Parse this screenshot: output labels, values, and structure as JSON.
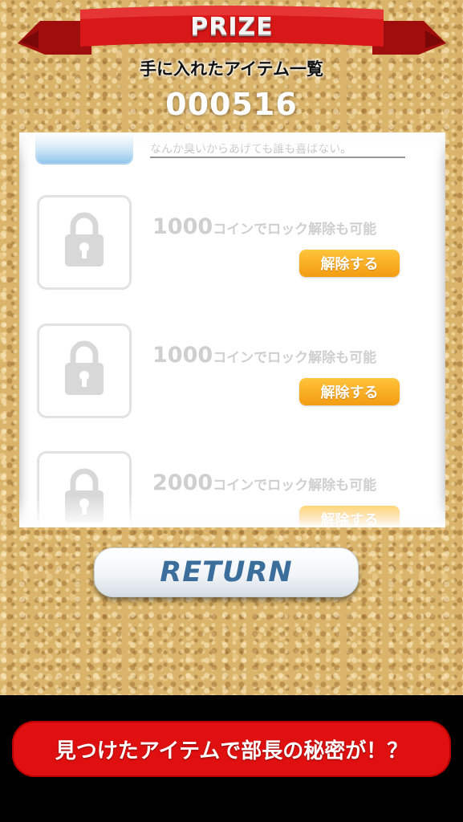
{
  "header": {
    "title": "PRIZE",
    "subtitle": "手に入れたアイテム一覧",
    "counter": "000516"
  },
  "list": {
    "partial_item_text": "なんか臭いからあげても誰も喜ばない。",
    "locked_items": [
      {
        "coins": "1000",
        "unlock_text": "コインでロック解除も可能",
        "button_label": "解除する"
      },
      {
        "coins": "1000",
        "unlock_text": "コインでロック解除も可能",
        "button_label": "解除する"
      },
      {
        "coins": "2000",
        "unlock_text": "コインでロック解除も可能",
        "button_label": "解除する"
      }
    ]
  },
  "return_label": "RETURN",
  "banner_text": "見つけたアイテムで部長の秘密が！？",
  "colors": {
    "ribbon": "#d81818",
    "unlock_button": "#f7a823",
    "return_text": "#3c6e9c",
    "banner": "#e01010"
  }
}
